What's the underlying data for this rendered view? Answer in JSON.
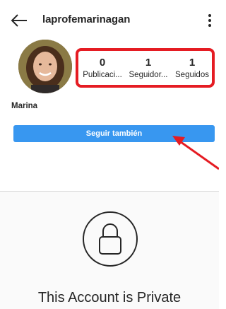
{
  "header": {
    "back_icon": "arrow-left-icon",
    "username": "laprofemarinagan",
    "more_icon": "more-vertical-icon"
  },
  "profile": {
    "display_name": "Marina",
    "stats": [
      {
        "value": "0",
        "label": "Publicaci..."
      },
      {
        "value": "1",
        "label": "Seguidor..."
      },
      {
        "value": "1",
        "label": "Seguidos"
      }
    ],
    "follow_button_label": "Seguir también"
  },
  "private": {
    "lock_icon": "lock-icon",
    "title": "This Account is Private"
  },
  "colors": {
    "accent": "#3897f0",
    "annotation": "#e51c23",
    "text": "#262626"
  }
}
